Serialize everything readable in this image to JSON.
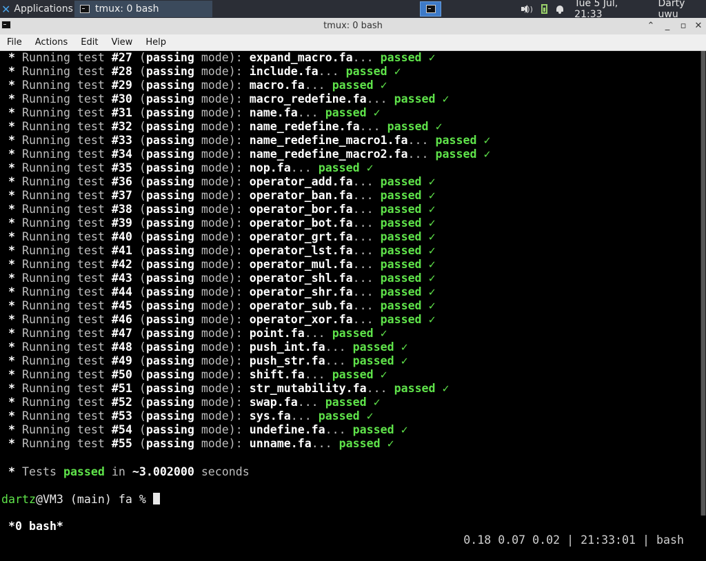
{
  "panel": {
    "apps_label": "Applications",
    "task_title": "tmux: 0 bash",
    "clock": "Tue  5 Jul, 21:33",
    "user": "Darty uwu"
  },
  "window": {
    "title": "tmux: 0 bash"
  },
  "menu": [
    "File",
    "Actions",
    "Edit",
    "View",
    "Help"
  ],
  "terminal": {
    "prefix": "Running test",
    "mode_open": "(",
    "mode_word1": "passing",
    "mode_word2": "mode):",
    "passed_word": "passed",
    "check": "✓",
    "tests": [
      {
        "num": "#27",
        "file": "expand_macro.fa"
      },
      {
        "num": "#28",
        "file": "include.fa"
      },
      {
        "num": "#29",
        "file": "macro.fa"
      },
      {
        "num": "#30",
        "file": "macro_redefine.fa"
      },
      {
        "num": "#31",
        "file": "name.fa"
      },
      {
        "num": "#32",
        "file": "name_redefine.fa"
      },
      {
        "num": "#33",
        "file": "name_redefine_macro1.fa"
      },
      {
        "num": "#34",
        "file": "name_redefine_macro2.fa"
      },
      {
        "num": "#35",
        "file": "nop.fa"
      },
      {
        "num": "#36",
        "file": "operator_add.fa"
      },
      {
        "num": "#37",
        "file": "operator_ban.fa"
      },
      {
        "num": "#38",
        "file": "operator_bor.fa"
      },
      {
        "num": "#39",
        "file": "operator_bot.fa"
      },
      {
        "num": "#40",
        "file": "operator_grt.fa"
      },
      {
        "num": "#41",
        "file": "operator_lst.fa"
      },
      {
        "num": "#42",
        "file": "operator_mul.fa"
      },
      {
        "num": "#43",
        "file": "operator_shl.fa"
      },
      {
        "num": "#44",
        "file": "operator_shr.fa"
      },
      {
        "num": "#45",
        "file": "operator_sub.fa"
      },
      {
        "num": "#46",
        "file": "operator_xor.fa"
      },
      {
        "num": "#47",
        "file": "point.fa"
      },
      {
        "num": "#48",
        "file": "push_int.fa"
      },
      {
        "num": "#49",
        "file": "push_str.fa"
      },
      {
        "num": "#50",
        "file": "shift.fa"
      },
      {
        "num": "#51",
        "file": "str_mutability.fa"
      },
      {
        "num": "#52",
        "file": "swap.fa"
      },
      {
        "num": "#53",
        "file": "sys.fa"
      },
      {
        "num": "#54",
        "file": "undefine.fa"
      },
      {
        "num": "#55",
        "file": "unname.fa"
      }
    ],
    "summary": {
      "pre": "Tests",
      "passed": "passed",
      "mid": "in",
      "duration": "~3.002000",
      "post": "seconds"
    },
    "prompt": {
      "user": "dartz",
      "host": "@VM3",
      "branch": "(main)",
      "dir": "fa",
      "symbol": "%"
    }
  },
  "statusbar": {
    "window": "*0 bash*",
    "load": "0.18 0.07 0.02",
    "time": "21:33:01",
    "process": "bash"
  }
}
